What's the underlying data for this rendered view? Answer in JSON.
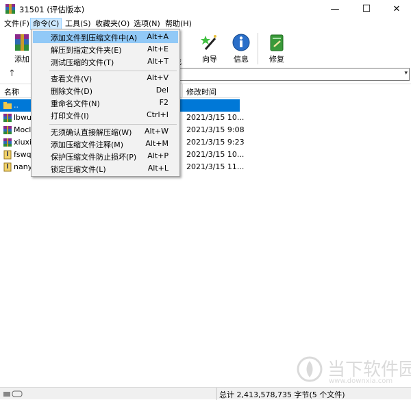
{
  "window": {
    "title": "31501 (评估版本)",
    "min": "—",
    "max": "☐",
    "close": "✕"
  },
  "menubar": [
    "文件(F)",
    "命令(C)",
    "工具(S)",
    "收藏夹(O)",
    "选项(N)",
    "帮助(H)"
  ],
  "toolbar": {
    "add": "添加",
    "wizard": "向导",
    "info": "信息",
    "repair": "修复",
    "find_partial": "找"
  },
  "list": {
    "col_name": "名称",
    "col_modified": "修改时间",
    "rows": [
      {
        "name": "..",
        "date": ""
      },
      {
        "name": "lbwu",
        "date": "2021/3/15 10..."
      },
      {
        "name": "Mocl",
        "date": "2021/3/15 9:08"
      },
      {
        "name": "xiuxiu",
        "date": "2021/3/15 9:23"
      },
      {
        "name": "fswq",
        "date": "2021/3/15 10..."
      },
      {
        "name": "nany",
        "date": "2021/3/15 11..."
      }
    ]
  },
  "dropdown": [
    {
      "label": "添加文件到压缩文件中(A)",
      "key": "Alt+A"
    },
    {
      "label": "解压到指定文件夹(E)",
      "key": "Alt+E"
    },
    {
      "label": "测试压缩的文件(T)",
      "key": "Alt+T"
    },
    {
      "label": "查看文件(V)",
      "key": "Alt+V"
    },
    {
      "label": "删除文件(D)",
      "key": "Del"
    },
    {
      "label": "重命名文件(N)",
      "key": "F2"
    },
    {
      "label": "打印文件(I)",
      "key": "Ctrl+I"
    },
    {
      "label": "无须确认直接解压缩(W)",
      "key": "Alt+W"
    },
    {
      "label": "添加压缩文件注释(M)",
      "key": "Alt+M"
    },
    {
      "label": "保护压缩文件防止损坏(P)",
      "key": "Alt+P"
    },
    {
      "label": "锁定压缩文件(L)",
      "key": "Alt+L"
    }
  ],
  "status": {
    "total": "总计 2,413,578,735 字节(5 个文件)"
  },
  "watermark": {
    "title": "当下软件园",
    "url": "www.downxia.com"
  }
}
